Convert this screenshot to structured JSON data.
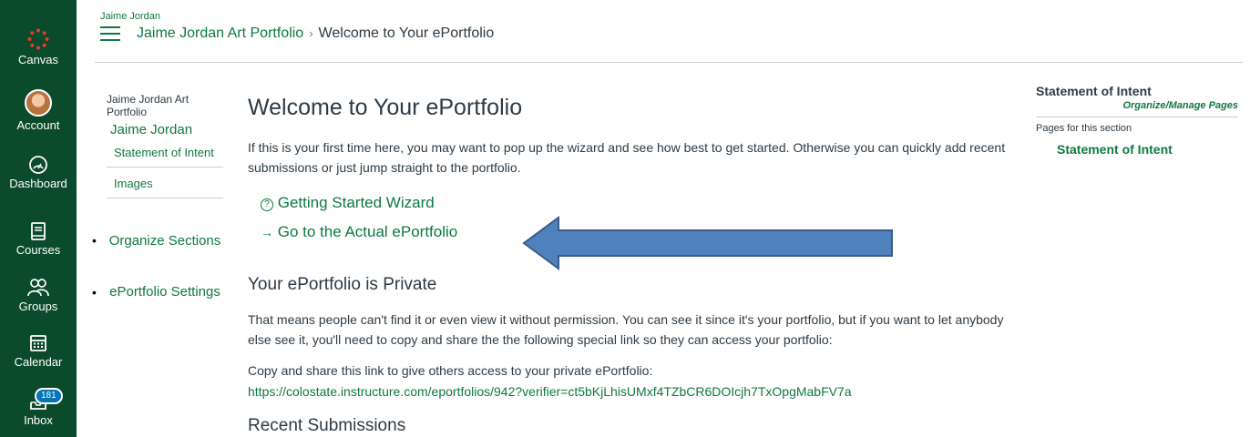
{
  "global_nav": {
    "items": [
      {
        "label": "Canvas",
        "icon": "canvas-logo-icon"
      },
      {
        "label": "Account",
        "icon": "avatar"
      },
      {
        "label": "Dashboard",
        "icon": "dashboard-icon"
      },
      {
        "label": "Courses",
        "icon": "book-icon"
      },
      {
        "label": "Groups",
        "icon": "groups-icon"
      },
      {
        "label": "Calendar",
        "icon": "calendar-icon"
      },
      {
        "label": "Inbox",
        "icon": "inbox-icon",
        "badge": "181"
      }
    ],
    "bg_color": "#0b4b2b"
  },
  "header": {
    "user_small": "Jaime Jordan",
    "breadcrumb": {
      "portfolio_link": "Jaime Jordan Art Portfolio",
      "separator": "›",
      "current": "Welcome to Your ePortfolio"
    }
  },
  "left_sidebar": {
    "portfolio_name": "Jaime Jordan Art Portfolio",
    "owner_name": "Jaime Jordan",
    "sections": [
      "Statement of Intent",
      "Images"
    ],
    "management_links": [
      "Organize Sections",
      "ePortfolio Settings"
    ]
  },
  "main": {
    "title": "Welcome to Your ePortfolio",
    "intro": "If this is your first time here, you may want to pop up the wizard and see how best to get started. Otherwise you can quickly add recent submissions or just jump straight to the portfolio.",
    "wizard_link": "Getting Started Wizard",
    "wizard_icon": "?",
    "go_link": "Go to the Actual ePortfolio",
    "go_icon": "→",
    "private_heading": "Your ePortfolio is Private",
    "private_text": "That means people can't find it or even view it without permission. You can see it since it's your portfolio, but if you want to let anybody else see it, you'll need to copy and share the the following special link so they can access your portfolio:",
    "share_label": "Copy and share this link to give others access to your private ePortfolio:",
    "share_url": "https://colostate.instructure.com/eportfolios/942?verifier=ct5bKjLhisUMxf4TZbCR6DOIcjh7TxOpgMabFV7a",
    "recent_heading": "Recent Submissions"
  },
  "right_sidebar": {
    "section_title": "Statement of Intent",
    "manage_link": "Organize/Manage Pages",
    "pages_label": "Pages for this section",
    "pages": [
      "Statement of Intent"
    ]
  },
  "colors": {
    "link_green": "#0d7a3e",
    "arrow_fill": "#4f81bd",
    "arrow_stroke": "#385d8a"
  }
}
